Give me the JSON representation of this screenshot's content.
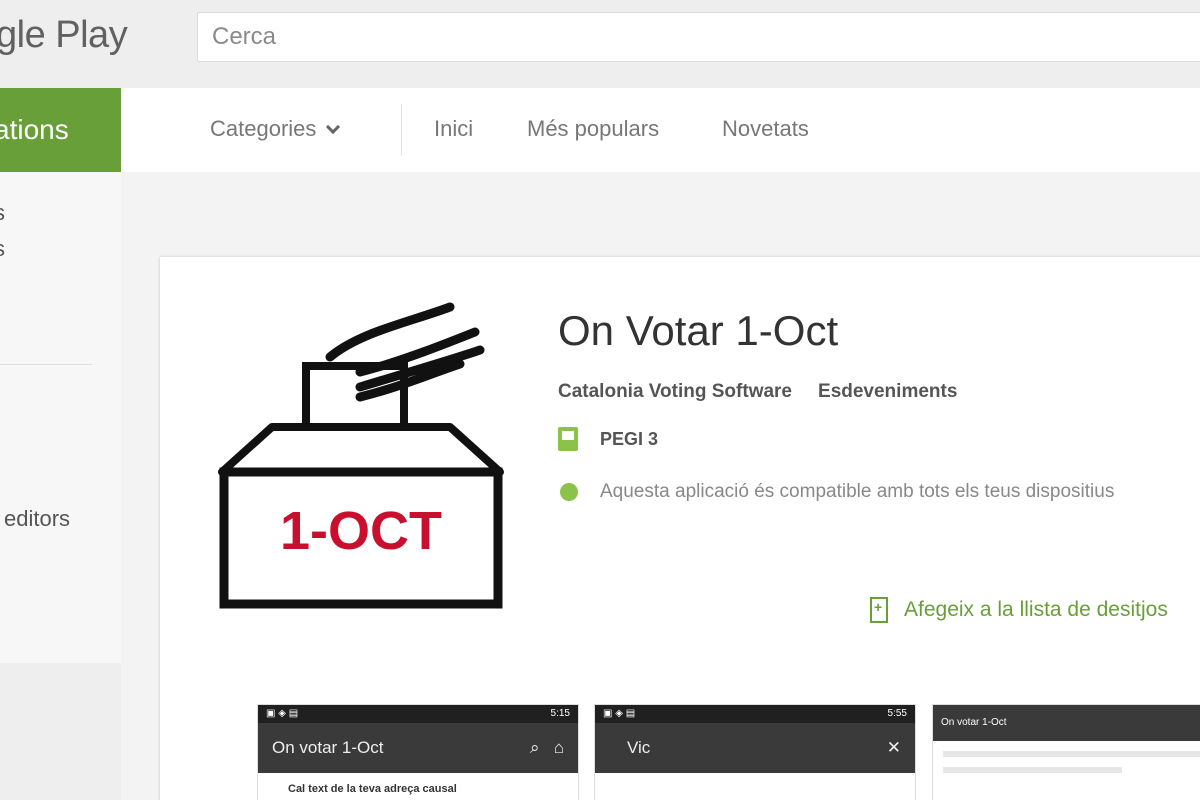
{
  "brand": {
    "text": "gle Play"
  },
  "search": {
    "placeholder": "Cerca"
  },
  "sidebar": {
    "active_label": "ations",
    "fragments": [
      "s",
      "s"
    ],
    "editors_label": "editors"
  },
  "nav": {
    "categories": "Categories",
    "home": "Inici",
    "popular": "Més populars",
    "new": "Novetats"
  },
  "app": {
    "icon_text": "1-OCT",
    "title": "On Votar 1-Oct",
    "developer": "Catalonia Voting Software",
    "category": "Esdeveniments",
    "rating": "PEGI 3",
    "compatibility": "Aquesta aplicació és compatible amb tots els teus dispositius",
    "wishlist": "Afegeix a la llista de desitjos"
  },
  "screenshots": [
    {
      "title": "On votar 1-Oct",
      "time": "5:15",
      "line": "Cal text de la teva adreça causal"
    },
    {
      "title": "Vic",
      "time": "5:55",
      "line": ""
    },
    {
      "title": "On votar 1-Oct",
      "time": "",
      "line": ""
    }
  ],
  "colors": {
    "accent": "#689f38",
    "icon_text": "#c8102e"
  }
}
